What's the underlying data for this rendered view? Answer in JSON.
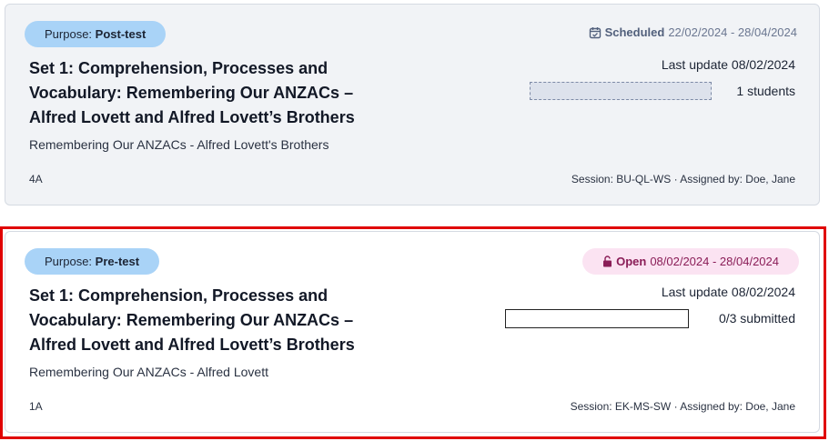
{
  "assignments": [
    {
      "purpose_prefix": "Purpose:",
      "purpose_value": "Post-test",
      "status_label": "Scheduled",
      "status_icon": "calendar-check-icon",
      "date_range": "22/02/2024 - 28/04/2024",
      "title": "Set 1: Comprehension, Processes and Vocabulary: Remembering Our ANZACs – Alfred Lovett and Alfred Lovett’s Brothers",
      "subtitle": "Remembering Our ANZACs - Alfred Lovett's Brothers",
      "last_update": "Last update 08/02/2024",
      "count_text": "1 students",
      "progress_fraction": 0,
      "class_label": "4A",
      "session_text": "Session: BU-QL-WS · Assigned by: Doe, Jane"
    },
    {
      "purpose_prefix": "Purpose:",
      "purpose_value": "Pre-test",
      "status_label": "Open",
      "status_icon": "unlock-icon",
      "date_range": "08/02/2024 - 28/04/2024",
      "title": "Set 1: Comprehension, Processes and Vocabulary: Remembering Our ANZACs – Alfred Lovett and Alfred Lovett’s Brothers",
      "subtitle": "Remembering Our ANZACs - Alfred Lovett",
      "last_update": "Last update 08/02/2024",
      "count_text": "0/3 submitted",
      "progress_fraction": 0,
      "class_label": "1A",
      "session_text": "Session: EK-MS-SW · Assigned by: Doe, Jane"
    }
  ],
  "colors": {
    "purpose_pill": "#a9d3f7",
    "open_pill": "#fbe3f2",
    "highlight_border": "#e00000",
    "scheduled_text": "#52607c"
  }
}
